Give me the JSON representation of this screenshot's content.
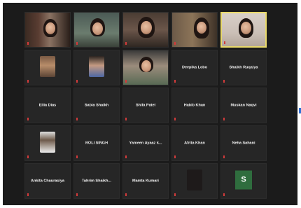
{
  "meeting": {
    "participants": [
      {
        "name": "",
        "tag": "",
        "kind": "video",
        "scene": "scene1"
      },
      {
        "name": "",
        "tag": "",
        "kind": "video",
        "scene": "scene2"
      },
      {
        "name": "",
        "tag": "",
        "kind": "video",
        "scene": "scene3"
      },
      {
        "name": "",
        "tag": "",
        "kind": "video",
        "scene": "scene4"
      },
      {
        "name": "",
        "tag": "",
        "kind": "video",
        "scene": "scene5",
        "active": true
      },
      {
        "name": "",
        "tag": "",
        "kind": "thumb",
        "scene": "scene-thumb-a"
      },
      {
        "name": "",
        "tag": "",
        "kind": "thumb",
        "scene": "scene-thumb-b"
      },
      {
        "name": "",
        "tag": "",
        "kind": "video",
        "scene": "scene-thumb-c"
      },
      {
        "name": "Deepika Lobo",
        "tag": "",
        "kind": "name"
      },
      {
        "name": "Shaikh Ruqaiya",
        "tag": "",
        "kind": "name"
      },
      {
        "name": "Ellia Dias",
        "tag": "",
        "kind": "name"
      },
      {
        "name": "Sabia Shaikh",
        "tag": "",
        "kind": "name"
      },
      {
        "name": "Shifa Patel",
        "tag": "",
        "kind": "name"
      },
      {
        "name": "Habib Khan",
        "tag": "",
        "kind": "name"
      },
      {
        "name": "Muskan Naqvi",
        "tag": "",
        "kind": "name"
      },
      {
        "name": "",
        "tag": "",
        "kind": "thumb",
        "scene": "scene-thumb-d"
      },
      {
        "name": "ROLI SINGH",
        "tag": "",
        "kind": "name"
      },
      {
        "name": "Yameen Ayaaz k...",
        "tag": "",
        "kind": "name"
      },
      {
        "name": "Afrita Khan",
        "tag": "",
        "kind": "name"
      },
      {
        "name": "Neha Sahani",
        "tag": "",
        "kind": "name"
      },
      {
        "name": "Ankita Chaurasiya",
        "tag": "",
        "kind": "name"
      },
      {
        "name": "Tahrim Shaikh...",
        "tag": "",
        "kind": "name"
      },
      {
        "name": "Mamta Kumari",
        "tag": "",
        "kind": "name"
      },
      {
        "name": "",
        "tag": "",
        "kind": "dark"
      },
      {
        "name": "",
        "tag": "",
        "kind": "letter",
        "letter": "S"
      }
    ]
  },
  "colors": {
    "background": "#1b1b1b",
    "tile": "#262626",
    "active_speaker_border": "#e9d96a",
    "mute_icon": "#d23a3a",
    "avatar_green": "#2f6d3e",
    "side_handle": "#2f6fd6"
  },
  "icons": [
    "muted-mic-icon",
    "panel-handle-icon"
  ]
}
